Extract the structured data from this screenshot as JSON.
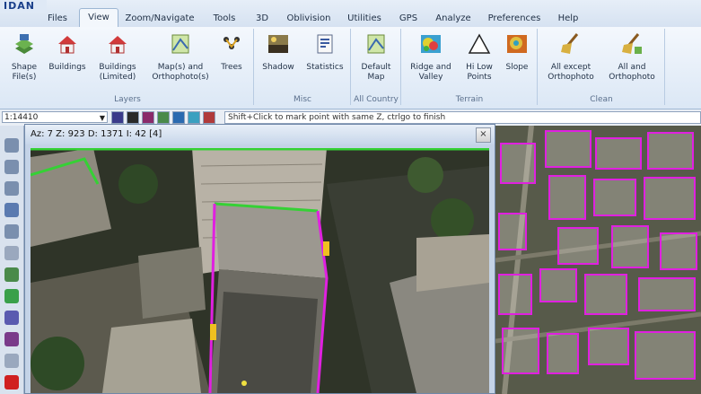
{
  "app": {
    "logo_text": "IDAN"
  },
  "menu": {
    "tabs": [
      {
        "label": "Files"
      },
      {
        "label": "View"
      },
      {
        "label": "Zoom/Navigate"
      },
      {
        "label": "Tools"
      },
      {
        "label": "3D"
      },
      {
        "label": "Oblivision"
      },
      {
        "label": "Utilities"
      },
      {
        "label": "GPS"
      },
      {
        "label": "Analyze"
      },
      {
        "label": "Preferences"
      },
      {
        "label": "Help"
      }
    ],
    "active_tab": "View"
  },
  "ribbon": {
    "buttons": [
      {
        "label": "Shape\nFile(s)"
      },
      {
        "label": "Buildings"
      },
      {
        "label": "Buildings\n(Limited)"
      },
      {
        "label": "Map(s) and\nOrthophoto(s)"
      },
      {
        "label": "Trees"
      },
      {
        "label": "Shadow"
      },
      {
        "label": "Statistics"
      },
      {
        "label": "Default\nMap"
      },
      {
        "label": "Ridge and\nValley"
      },
      {
        "label": "Hi Low\nPoints"
      },
      {
        "label": "Slope"
      },
      {
        "label": "All except\nOrthophoto"
      },
      {
        "label": "All and\nOrthophoto"
      }
    ],
    "groups": [
      {
        "label": "Layers"
      },
      {
        "label": "Misc"
      },
      {
        "label": "All Country"
      },
      {
        "label": "Terrain"
      },
      {
        "label": "Clean"
      }
    ]
  },
  "toolbar": {
    "scale_value": "1:14410",
    "hint_text": "Shift+Click to mark point with same Z, ctrlgo to finish"
  },
  "view3d": {
    "title": "Az: 7 Z: 923 D: 1371 I: 42 [4]",
    "close_label": "×"
  },
  "colors": {
    "outline": "#e020e0",
    "highlight": "#35d135",
    "accent": "#f0c020"
  }
}
